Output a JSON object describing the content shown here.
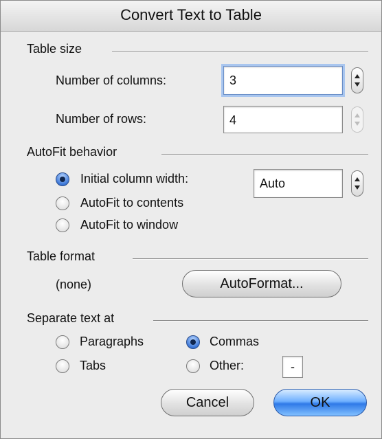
{
  "dialog": {
    "title": "Convert Text to Table"
  },
  "table_size": {
    "heading": "Table size",
    "columns_label": "Number of columns:",
    "columns_value": "3",
    "rows_label": "Number of rows:",
    "rows_value": "4"
  },
  "autofit": {
    "heading": "AutoFit behavior",
    "options": [
      {
        "label": "Initial column width:",
        "checked": true
      },
      {
        "label": "AutoFit to contents",
        "checked": false
      },
      {
        "label": "AutoFit to window",
        "checked": false
      }
    ],
    "column_width_value": "Auto"
  },
  "table_format": {
    "heading": "Table format",
    "current": "(none)",
    "autoformat_label": "AutoFormat..."
  },
  "separate": {
    "heading": "Separate text at",
    "options": [
      {
        "label": "Paragraphs",
        "checked": false
      },
      {
        "label": "Commas",
        "checked": true
      },
      {
        "label": "Tabs",
        "checked": false
      },
      {
        "label": "Other:",
        "checked": false
      }
    ],
    "other_value": "-"
  },
  "buttons": {
    "cancel": "Cancel",
    "ok": "OK"
  }
}
